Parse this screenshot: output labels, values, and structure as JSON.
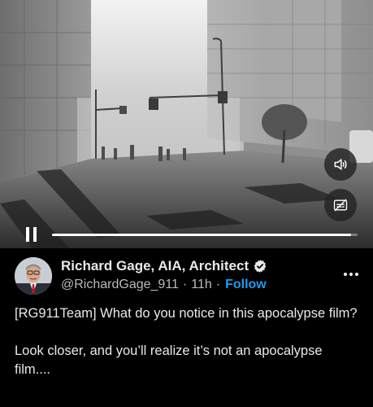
{
  "video": {
    "progress": 0.98,
    "controls": {
      "pause_icon": "pause-icon",
      "volume_icon": "speaker-volume-icon",
      "captions_icon": "captions-off-icon"
    }
  },
  "post": {
    "author": {
      "display_name": "Richard Gage, AIA, Architect",
      "handle": "@RichardGage_911",
      "verified_icon": "verified-badge-icon",
      "verified_color": "#e7e9ea"
    },
    "time": "11h",
    "separator": "·",
    "follow_label": "Follow",
    "follow_color": "#1d9bf0",
    "more_icon": "more-options-icon",
    "text_paragraphs": [
      "[RG911Team] What do you notice in this apocalypse film?",
      "Look closer, and you’ll realize it’s not an apocalypse film...."
    ]
  }
}
